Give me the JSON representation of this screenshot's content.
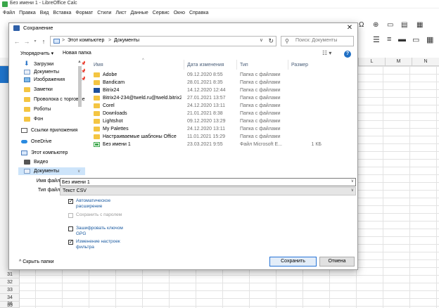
{
  "calc": {
    "window_title": "Без имени 1 - LibreOffice Calc",
    "menu": [
      "Файл",
      "Правка",
      "Вид",
      "Вставка",
      "Формат",
      "Стили",
      "Лист",
      "Данные",
      "Сервис",
      "Окно",
      "Справка"
    ],
    "columns": [
      "L",
      "M",
      "N"
    ],
    "rows": [
      "31",
      "32",
      "33",
      "34",
      "35",
      "36"
    ]
  },
  "dialog": {
    "title": "Сохранение",
    "address": {
      "root": "Этот компьютер",
      "folder": "Документы",
      "separator": ">"
    },
    "search_placeholder": "Поиск: Документы",
    "organize_label": "Упорядочить ▾",
    "new_folder_label": "Новая папка",
    "nav_items": [
      {
        "label": "Загрузки",
        "icon": "download-icon",
        "pinned": true
      },
      {
        "label": "Документы",
        "icon": "documents-icon",
        "pinned": true
      },
      {
        "label": "Изображения",
        "icon": "images-icon",
        "pinned": true
      },
      {
        "label": "Заметки",
        "icon": "folder-icon",
        "pinned": false
      },
      {
        "label": "Проволока с торговые",
        "icon": "folder-icon",
        "pinned": false
      },
      {
        "label": "Роботы",
        "icon": "folder-icon",
        "pinned": false
      },
      {
        "label": "Фон",
        "icon": "folder-icon",
        "pinned": false
      },
      {
        "label": "Ссылки приложения",
        "icon": "link-icon",
        "pinned": false
      },
      {
        "label": "OneDrive",
        "icon": "cloud-icon",
        "pinned": false
      },
      {
        "label": "Этот компьютер",
        "icon": "computer-icon",
        "pinned": false
      },
      {
        "label": "Видео",
        "icon": "video-icon",
        "pinned": false
      },
      {
        "label": "Документы",
        "icon": "documents-icon",
        "pinned": false,
        "selected": true
      }
    ],
    "columns": {
      "name": "Имя",
      "date": "Дата изменения",
      "type": "Тип",
      "size": "Размер"
    },
    "files": [
      {
        "name": "Adobe",
        "date": "09.12.2020 8:55",
        "type": "Папка с файлами",
        "size": "",
        "icon": "folder-icon"
      },
      {
        "name": "Bandicam",
        "date": "28.01.2021 8:35",
        "type": "Папка с файлами",
        "size": "",
        "icon": "folder-icon"
      },
      {
        "name": "Bitrix24",
        "date": "14.12.2020 12:44",
        "type": "Папка с файлами",
        "size": "",
        "icon": "app-folder-icon"
      },
      {
        "name": "Bitrix24-234@tweld.ru@tweld.bitrix24.ru",
        "date": "27.01.2021 13:57",
        "type": "Папка с файлами",
        "size": "",
        "icon": "folder-icon"
      },
      {
        "name": "Corel",
        "date": "24.12.2020 13:11",
        "type": "Папка с файлами",
        "size": "",
        "icon": "folder-icon"
      },
      {
        "name": "Downloads",
        "date": "21.01.2021 8:38",
        "type": "Папка с файлами",
        "size": "",
        "icon": "folder-icon"
      },
      {
        "name": "Lightshot",
        "date": "09.12.2020 13:29",
        "type": "Папка с файлами",
        "size": "",
        "icon": "folder-icon"
      },
      {
        "name": "My Palettes",
        "date": "24.12.2020 13:11",
        "type": "Папка с файлами",
        "size": "",
        "icon": "folder-icon"
      },
      {
        "name": "Настраиваемые шаблоны Office",
        "date": "11.01.2021 15:29",
        "type": "Папка с файлами",
        "size": "",
        "icon": "folder-icon"
      },
      {
        "name": "Без имени 1",
        "date": "23.03.2021 9:55",
        "type": "Файл Microsoft E...",
        "size": "1 КБ",
        "icon": "spreadsheet-icon"
      }
    ],
    "filename_label": "Имя файла:",
    "filename_value": "Без имени 1",
    "filetype_label": "Тип файла:",
    "filetype_value": "Текст CSV",
    "options": [
      {
        "label": "Автоматическое расширение",
        "checked": true,
        "enabled": true
      },
      {
        "label": "Сохранить с паролем",
        "checked": false,
        "enabled": false
      },
      {
        "label": "Зашифровать ключом GPG",
        "checked": false,
        "enabled": true
      },
      {
        "label": "Изменение настроек фильтра",
        "checked": true,
        "enabled": true
      }
    ],
    "hide_folders_label": "Скрыть папки",
    "save_label": "Сохранить",
    "cancel_label": "Отмена"
  }
}
